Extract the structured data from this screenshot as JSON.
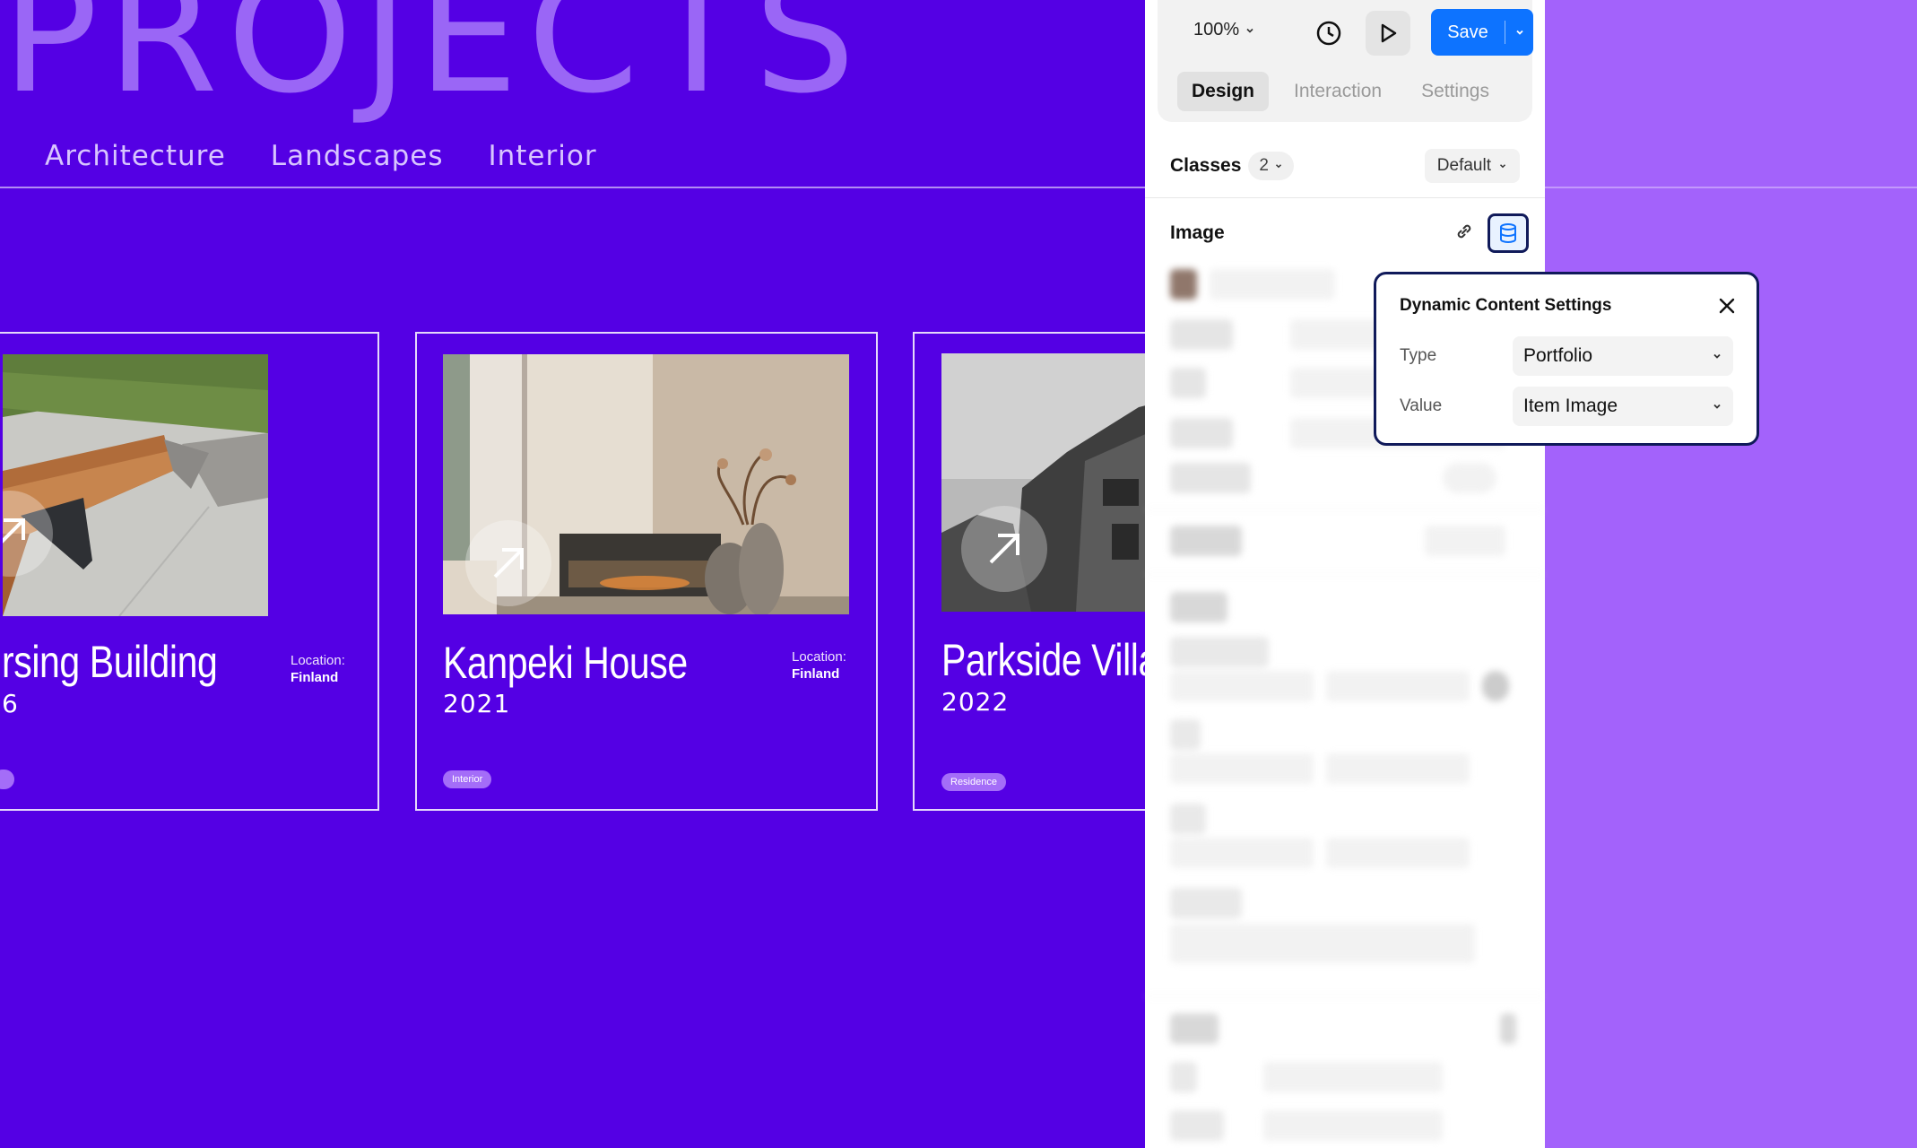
{
  "canvas": {
    "hero_title": "PROJECTS",
    "nav": [
      "Architecture",
      "Landscapes",
      "Interior"
    ],
    "cards": [
      {
        "title": "rsing Building",
        "year": "6",
        "location_label": "Location:",
        "location_value": "Finland",
        "tag": ""
      },
      {
        "title": "Kanpeki House",
        "year": "2021",
        "location_label": "Location:",
        "location_value": "Finland",
        "tag": "Interior"
      },
      {
        "title": "Parkside Villa",
        "year": "2022",
        "location_label": "",
        "location_value": "",
        "tag": "Residence"
      }
    ]
  },
  "toolbar": {
    "zoom": "100%",
    "save_label": "Save",
    "tabs": [
      "Design",
      "Interaction",
      "Settings"
    ],
    "active_tab": "Design"
  },
  "panel": {
    "classes_label": "Classes",
    "classes_count": "2",
    "state_select": "Default",
    "image_section": "Image"
  },
  "popup": {
    "title": "Dynamic Content Settings",
    "type_label": "Type",
    "type_value": "Portfolio",
    "value_label": "Value",
    "value_value": "Item Image"
  },
  "colors": {
    "canvas_bg": "#5400e4",
    "accent_bg": "#a362fb",
    "save_button": "#0d73ff",
    "popup_border": "#101a5a"
  }
}
